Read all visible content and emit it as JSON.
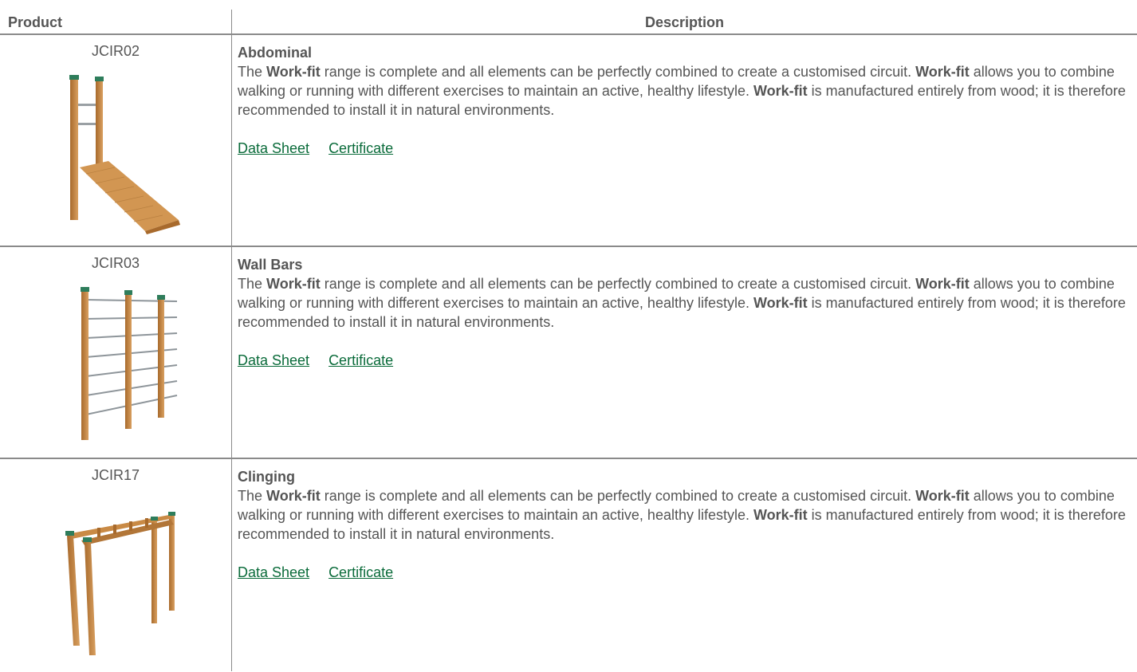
{
  "header": {
    "product": "Product",
    "description": "Description"
  },
  "brand": "Work-fit",
  "desc_parts": {
    "p1_pre": "The ",
    "p1_post": " range is complete and all elements can be perfectly combined to create a customised circuit. ",
    "p2_post": " allows you to combine walking or running with different exercises to maintain an active, healthy lifestyle. ",
    "p3_post": " is manufactured entirely from wood; it is therefore recommended to install it in natural environments."
  },
  "links": {
    "data_sheet": "Data Sheet",
    "certificate": "Certificate"
  },
  "products": [
    {
      "code": "JCIR02",
      "name": "Abdominal",
      "image": "abdominal-bench-image"
    },
    {
      "code": "JCIR03",
      "name": "Wall Bars",
      "image": "wall-bars-image"
    },
    {
      "code": "JCIR17",
      "name": "Clinging",
      "image": "monkey-bars-image"
    }
  ],
  "colors": {
    "text": "#555555",
    "link": "#0a6b3a",
    "rule": "#8a8a8a",
    "wood": "#c98a45",
    "cap": "#2e7d5b"
  }
}
